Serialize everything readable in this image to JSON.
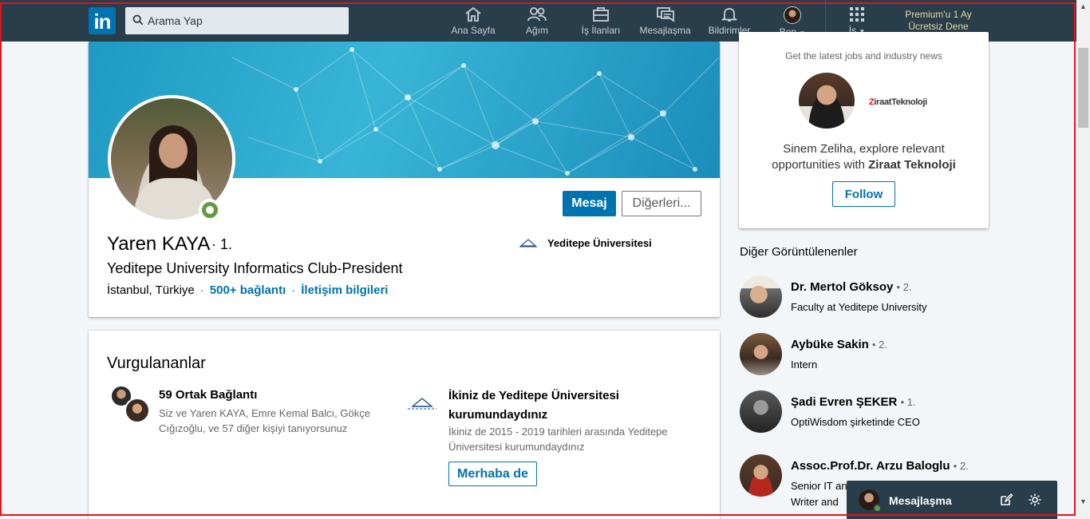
{
  "nav": {
    "search_placeholder": "Arama Yap",
    "items": [
      {
        "label": "Ana Sayfa",
        "icon": "home-icon"
      },
      {
        "label": "Ağım",
        "icon": "network-icon"
      },
      {
        "label": "İş İlanları",
        "icon": "jobs-icon"
      },
      {
        "label": "Mesajlaşma",
        "icon": "messaging-icon"
      },
      {
        "label": "Bildirimler",
        "icon": "notifications-icon"
      },
      {
        "label": "Ben",
        "icon": "avatar"
      },
      {
        "label": "İş",
        "icon": "grid-icon"
      }
    ],
    "premium_line1": "Premium'u 1 Ay",
    "premium_line2": "Ücretsiz Dene"
  },
  "profile": {
    "name": "Yaren KAYA",
    "degree": "· 1.",
    "headline": "Yeditepe University Informatics Club-President",
    "location": "İstanbul, Türkiye",
    "connections": "500+ bağlantı",
    "contact_info": "İletişim bilgileri",
    "education": "Yeditepe Üniversitesi",
    "message_button": "Mesaj",
    "more_button": "Diğerleri..."
  },
  "highlights": {
    "title": "Vurgulananlar",
    "mutual_title": "59 Ortak Bağlantı",
    "mutual_desc": "Siz ve Yaren KAYA, Emre Kemal Balcı, Gökçe Cığızoğlu, ve 57 diğer kişiyi tanıyorsunuz",
    "school_title": "İkiniz de Yeditepe Üniversitesi kurumundaydınız",
    "school_desc": "İkiniz de 2015 - 2019 tarihleri arasında Yeditepe Üniversitesi kurumundaydınız",
    "say_hi_button": "Merhaba de"
  },
  "ad": {
    "tagline": "Get the latest jobs and industry news",
    "company_logo_prefix": "Z",
    "company_logo_text": "iraatTeknoloji",
    "text_before": "Sinem Zeliha, explore relevant opportunities with ",
    "company": "Ziraat Teknoloji",
    "follow_button": "Follow"
  },
  "also_viewed": {
    "title": "Diğer Görüntülenenler",
    "people": [
      {
        "name": "Dr. Mertol Göksoy",
        "degree": "• 2.",
        "job": "Faculty at Yeditepe University"
      },
      {
        "name": "Aybüke Sakin",
        "degree": "• 2.",
        "job": "Intern"
      },
      {
        "name": "Şadi Evren ŞEKER",
        "degree": "• 1.",
        "job": "OptiWisdom şirketinde CEO"
      },
      {
        "name": "Assoc.Prof.Dr. Arzu Baloglu",
        "degree": "• 2.",
        "job": "Senior IT and Business Consultant Writer and"
      }
    ]
  },
  "messaging": {
    "title": "Mesajlaşma"
  },
  "colors": {
    "nav_bg": "#283e4a",
    "brand_blue": "#0073b1",
    "online_green": "#5f9b41",
    "premium_gold": "#e7d9a3"
  }
}
